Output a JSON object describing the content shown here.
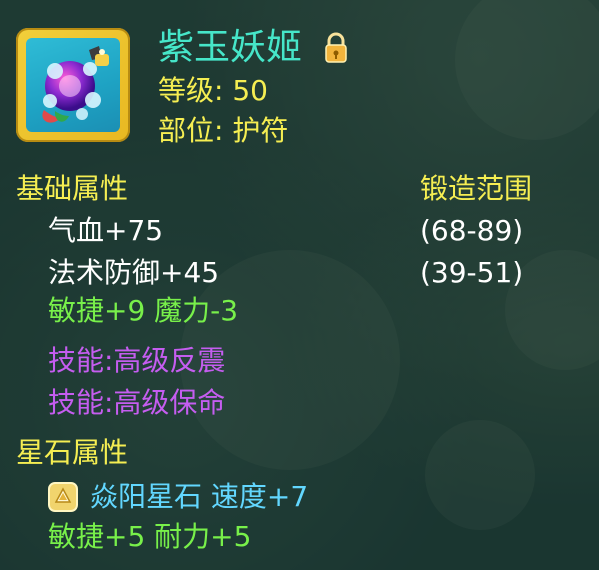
{
  "item": {
    "name": "紫玉妖姬",
    "level_line": "等级: 50",
    "slot_line": "部位: 护符",
    "icon": "amulet-icon",
    "locked_icon": "lock-icon"
  },
  "sections": {
    "basic_title": "基础属性",
    "forge_title": "锻造范围",
    "star_title": "星石属性"
  },
  "basic_stats": [
    {
      "label": "气血+75",
      "range": "(68-89)"
    },
    {
      "label": "法术防御+45",
      "range": "(39-51)"
    }
  ],
  "green_stats": "敏捷+9 魔力-3",
  "skills": [
    "技能:高级反震",
    "技能:高级保命"
  ],
  "star_stone": {
    "icon": "star-stone-icon",
    "name_line": "焱阳星石 速度+7",
    "bonus_line": "敏捷+5 耐力+5"
  },
  "colors": {
    "title": "#46e6c9",
    "header": "#f5ee52",
    "green": "#78f04a",
    "purple": "#c55df0",
    "cyan": "#62d7ff"
  }
}
